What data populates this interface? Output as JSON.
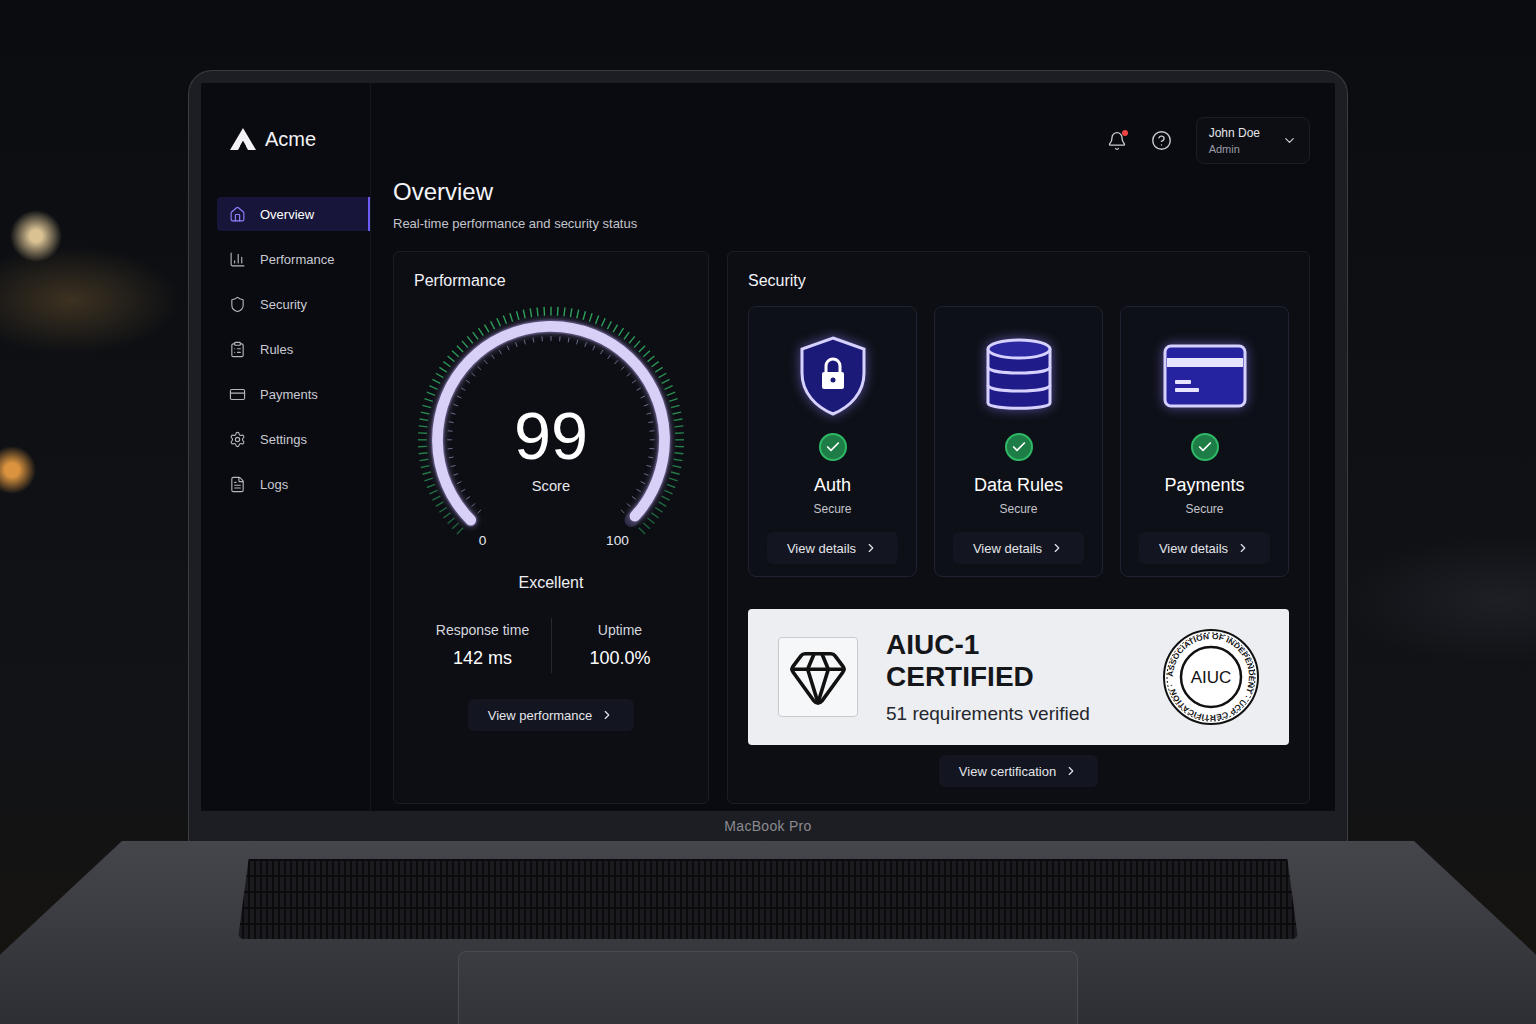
{
  "device": {
    "label": "MacBook Pro"
  },
  "app": {
    "name": "Acme"
  },
  "header": {
    "notifications": true,
    "user": {
      "name": "John Doe",
      "role": "Admin"
    }
  },
  "sidebar": {
    "items": [
      {
        "label": "Overview",
        "selected": true
      },
      {
        "label": "Performance",
        "selected": false
      },
      {
        "label": "Security",
        "selected": false
      },
      {
        "label": "Rules",
        "selected": false
      },
      {
        "label": "Payments",
        "selected": false
      },
      {
        "label": "Settings",
        "selected": false
      },
      {
        "label": "Logs",
        "selected": false
      }
    ]
  },
  "page": {
    "title": "Overview",
    "subtitle": "Real-time performance and security status"
  },
  "performance": {
    "title": "Performance",
    "score": "99",
    "score_label": "Score",
    "level": 0.99,
    "min": "0",
    "max": "100",
    "rating": "Excellent",
    "stats": [
      {
        "label": "Response time",
        "value": "142 ms"
      },
      {
        "label": "Uptime",
        "value": "100.0%"
      }
    ],
    "button": "View performance"
  },
  "security": {
    "title": "Security",
    "items": [
      {
        "name": "Auth",
        "status": "Secure",
        "ok": true,
        "button": "View details"
      },
      {
        "name": "Data Rules",
        "status": "Secure",
        "ok": true,
        "button": "View details"
      },
      {
        "name": "Payments",
        "status": "Secure",
        "ok": true,
        "button": "View details"
      }
    ],
    "certification": {
      "title": "AIUC-1 CERTIFIED",
      "subtitle": "51 requirements verified",
      "seal": "AIUC",
      "seal_ring": "ASSOCIATION OF INDEPENDENT · UCP CERTIFICATION ·",
      "button": "View certification"
    }
  }
}
